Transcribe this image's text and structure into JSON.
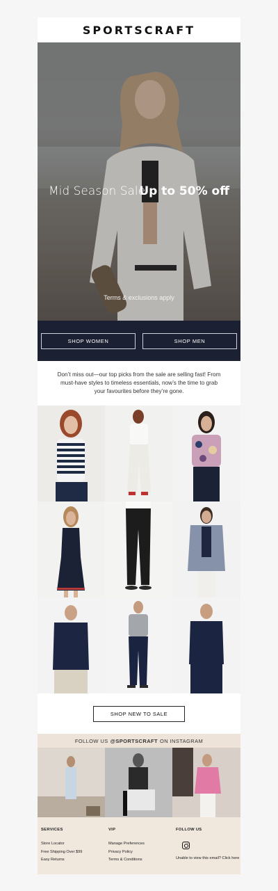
{
  "brand": {
    "logo_text": "SPORTSCRAFT"
  },
  "hero": {
    "headline_left": "Mid Season Sale",
    "headline_right": "Up to 50% off",
    "terms": "Terms & exclusions apply"
  },
  "cta": {
    "women": "SHOP WOMEN",
    "men": "SHOP MEN"
  },
  "intro_text": "Don’t miss out—our top picks from the sale are selling fast! From must-have styles to timeless essentials, now’s the time to grab your favourites before they’re gone.",
  "shop_new_label": "SHOP NEW TO SALE",
  "instagram": {
    "prefix": "FOLLOW US",
    "handle": "@SPORTSCRAFT",
    "suffix": "ON INSTAGRAM"
  },
  "footer": {
    "services_heading": "SERVICES",
    "services": [
      "Store Locator",
      "Free Shipping Over $99",
      "Easy Returns"
    ],
    "vip_heading": "VIP",
    "vip": [
      "Manage Preferences",
      "Privacy Policy",
      "Terms & Conditions"
    ],
    "follow_heading": "FOLLOW US",
    "unable_text": "Unable to view this email? Click here"
  },
  "colors": {
    "navy": "#1b2033",
    "sand": "#ede3d9",
    "footer_bg": "#f0e7dd"
  },
  "icons": {
    "instagram": "instagram-icon"
  }
}
